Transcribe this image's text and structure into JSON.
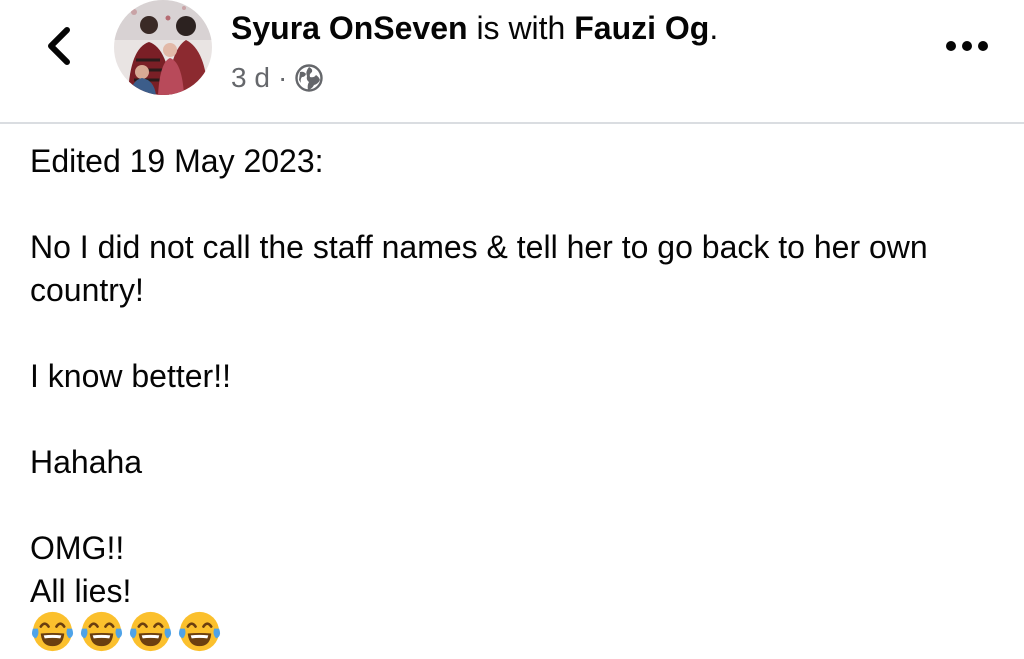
{
  "header": {
    "author_name": "Syura OnSeven",
    "with_text": " is with ",
    "tagged_name": "Fauzi Og",
    "period": ".",
    "time": "3 d",
    "separator": "·",
    "audience_icon": "globe-icon",
    "back_icon": "chevron-left-icon",
    "more_icon": "more-horizontal-icon"
  },
  "post": {
    "edited_line": "Edited 19 May 2023:",
    "paragraph_1": "No I did not call the staff names & tell her to go back to her own country!",
    "paragraph_2": "I know better!!",
    "paragraph_3": "Hahaha",
    "line_omg": "OMG!!",
    "line_lies": "All lies!",
    "emojis": [
      "face-with-tears-of-joy-emoji",
      "face-with-tears-of-joy-emoji",
      "face-with-tears-of-joy-emoji",
      "face-with-tears-of-joy-emoji"
    ]
  },
  "colors": {
    "text": "#050505",
    "secondary_text": "#65676b",
    "divider": "#dadde1",
    "emoji_yellow": "#fbc02d",
    "tear_blue": "#4fa3e8"
  }
}
